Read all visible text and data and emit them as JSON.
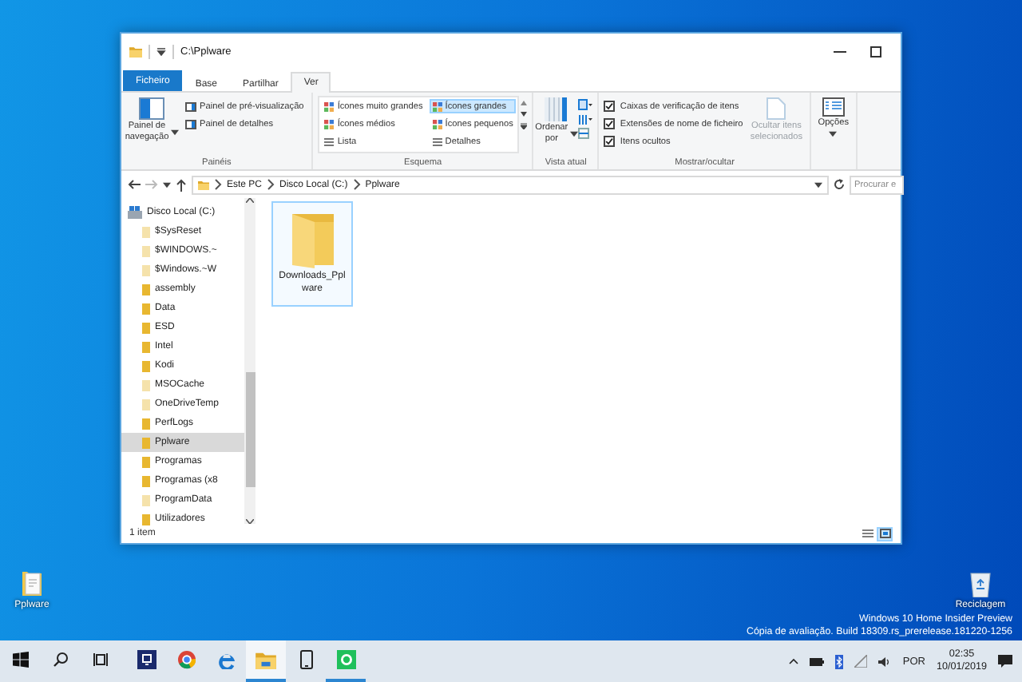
{
  "window": {
    "title": "C:\\Pplware"
  },
  "ribbon_tabs": [
    {
      "label": "Ficheiro",
      "kind": "file",
      "selected": false
    },
    {
      "label": "Base",
      "kind": "tab",
      "selected": false
    },
    {
      "label": "Partilhar",
      "kind": "tab",
      "selected": false
    },
    {
      "label": "Ver",
      "kind": "tab",
      "selected": true
    }
  ],
  "ribbon": {
    "panes": {
      "label": "Painéis",
      "navigation_pane": "Painel de navegação",
      "buttons": [
        "Painel de pré-visualização",
        "Painel de detalhes"
      ]
    },
    "layout": {
      "label": "Esquema",
      "options": [
        {
          "label": "Ícones muito grandes",
          "selected": false
        },
        {
          "label": "Ícones médios",
          "selected": false
        },
        {
          "label": "Lista",
          "selected": false
        },
        {
          "label": "Ícones grandes",
          "selected": true
        },
        {
          "label": "Ícones pequenos",
          "selected": false
        },
        {
          "label": "Detalhes",
          "selected": false
        }
      ]
    },
    "current_view": {
      "label": "Vista atual",
      "sort": "Ordenar por"
    },
    "show_hide": {
      "label": "Mostrar/ocultar",
      "checkboxes": [
        {
          "label": "Caixas de verificação de itens",
          "checked": true
        },
        {
          "label": "Extensões de nome de ficheiro",
          "checked": true
        },
        {
          "label": "Itens ocultos",
          "checked": true
        }
      ],
      "hide_selected": {
        "label": "Ocultar itens selecionados",
        "disabled": true
      }
    },
    "options": {
      "label": "Opções"
    }
  },
  "address_bar": {
    "breadcrumbs": [
      "Este PC",
      "Disco Local (C:)",
      "Pplware"
    ]
  },
  "search": {
    "placeholder": "Procurar e"
  },
  "sidebar": {
    "items": [
      {
        "label": "Disco Local (C:)",
        "selected": false,
        "children": [
          {
            "label": "$SysReset",
            "hidden": true,
            "selected": false
          },
          {
            "label": "$WINDOWS.~",
            "hidden": true,
            "selected": false
          },
          {
            "label": "$Windows.~W",
            "hidden": true,
            "selected": false
          },
          {
            "label": "assembly",
            "hidden": false,
            "selected": false
          },
          {
            "label": "Data",
            "hidden": false,
            "selected": false
          },
          {
            "label": "ESD",
            "hidden": false,
            "selected": false
          },
          {
            "label": "Intel",
            "hidden": false,
            "selected": false
          },
          {
            "label": "Kodi",
            "hidden": false,
            "selected": false
          },
          {
            "label": "MSOCache",
            "hidden": true,
            "selected": false
          },
          {
            "label": "OneDriveTemp",
            "hidden": true,
            "selected": false
          },
          {
            "label": "PerfLogs",
            "hidden": false,
            "selected": false
          },
          {
            "label": "Pplware",
            "hidden": false,
            "selected": true
          },
          {
            "label": "Programas",
            "hidden": false,
            "selected": false
          },
          {
            "label": "Programas (x8",
            "hidden": false,
            "selected": false
          },
          {
            "label": "ProgramData",
            "hidden": true,
            "selected": false
          },
          {
            "label": "Utilizadores",
            "hidden": false,
            "selected": false
          }
        ]
      }
    ]
  },
  "files": [
    {
      "name": "Downloads_Pplware",
      "selected": true
    }
  ],
  "status_bar": {
    "count": "1 item",
    "views": [
      {
        "kind": "details",
        "selected": false
      },
      {
        "kind": "large_icons",
        "selected": true
      }
    ]
  },
  "desktop_icons": [
    {
      "label": "Pplware",
      "kind": "document"
    },
    {
      "label": "Reciclagem",
      "kind": "recycle_bin"
    }
  ],
  "build_info": [
    "Windows 10 Home Insider Preview",
    "Cópia de avaliação. Build 18309.rs_prerelease.181220-1256"
  ],
  "taskbar": {
    "apps": [
      {
        "kind": "start",
        "running": false,
        "selected": false
      },
      {
        "kind": "search",
        "running": false,
        "selected": false
      },
      {
        "kind": "task_view",
        "running": false,
        "selected": false
      },
      {
        "kind": "dark_app",
        "running": false,
        "selected": false
      },
      {
        "kind": "browser",
        "running": false,
        "selected": false
      },
      {
        "kind": "web",
        "running": false,
        "selected": false
      },
      {
        "kind": "explorer",
        "running": true,
        "selected": true
      },
      {
        "kind": "phone",
        "running": false,
        "selected": false
      },
      {
        "kind": "chat",
        "running": true,
        "selected": false
      }
    ],
    "tray": {
      "language": "POR",
      "time": "02:35",
      "date": "10/01/2019"
    }
  }
}
